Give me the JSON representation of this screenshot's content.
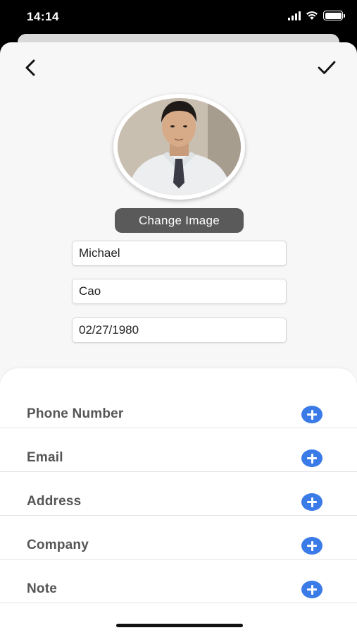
{
  "status_bar": {
    "time": "14:14",
    "icons": [
      "cellular-signal-icon",
      "wifi-icon",
      "battery-icon"
    ]
  },
  "nav": {
    "back_icon": "chevron-left-icon",
    "done_icon": "checkmark-icon"
  },
  "profile": {
    "photo": "profile-photo",
    "change_image_label": "Change Image",
    "first_name": "Michael",
    "last_name": "Cao",
    "birth_date": "02/27/1980"
  },
  "details": {
    "rows": [
      {
        "label": "Phone Number",
        "icon": "plus-circle-icon"
      },
      {
        "label": "Email",
        "icon": "plus-circle-icon"
      },
      {
        "label": "Address",
        "icon": "plus-circle-icon"
      },
      {
        "label": "Company",
        "icon": "plus-circle-icon"
      },
      {
        "label": "Note",
        "icon": "plus-circle-icon"
      }
    ]
  },
  "colors": {
    "accent": "#3a7be8",
    "button_dark": "#5a5a5a",
    "label_text": "#555555"
  }
}
